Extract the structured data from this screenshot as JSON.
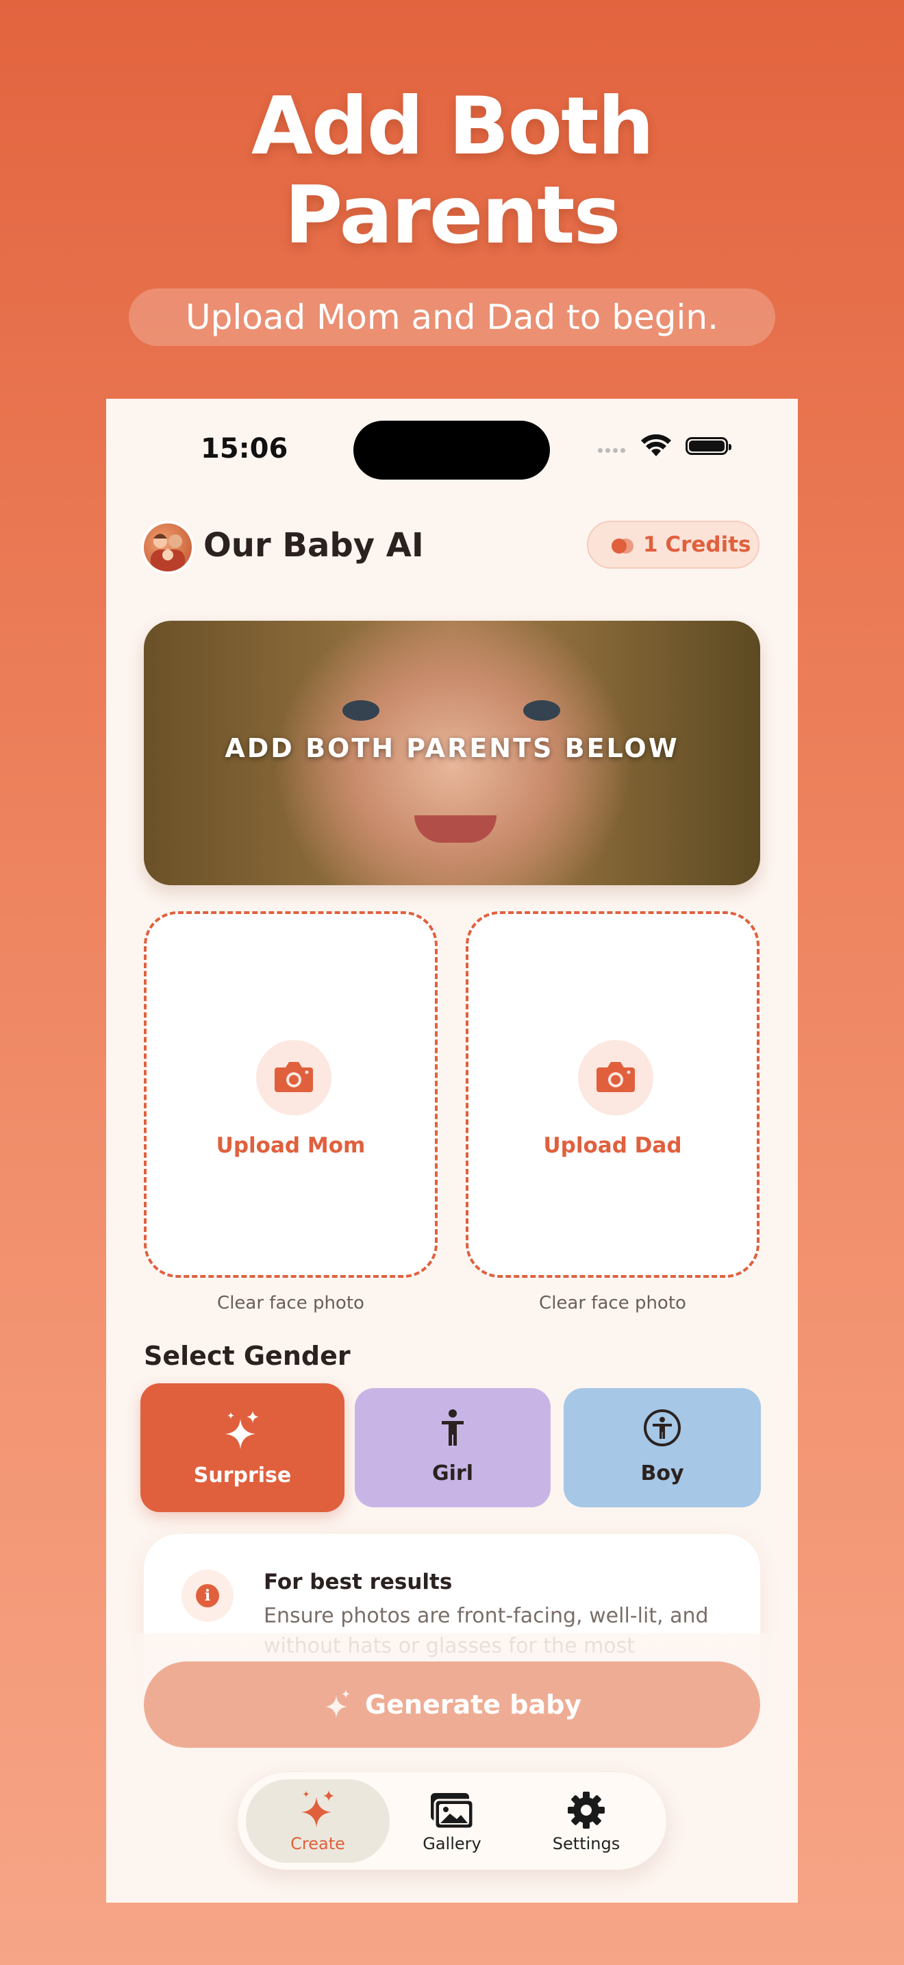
{
  "promo": {
    "headline_line1": "Add Both",
    "headline_line2": "Parents",
    "subtitle": "Upload Mom and Dad to begin."
  },
  "status_bar": {
    "time": "15:06"
  },
  "header": {
    "app_title": "Our Baby AI",
    "credits_label": "1 Credits"
  },
  "hero": {
    "overlay_text": "ADD BOTH PARENTS BELOW"
  },
  "uploads": {
    "mom": {
      "label": "Upload Mom",
      "caption": "Clear face photo"
    },
    "dad": {
      "label": "Upload Dad",
      "caption": "Clear face photo"
    }
  },
  "gender": {
    "title": "Select Gender",
    "options": [
      {
        "label": "Surprise",
        "icon": "sparkles-icon",
        "selected": true,
        "color": "#e0603d"
      },
      {
        "label": "Girl",
        "icon": "person-icon",
        "selected": false,
        "color": "#c8b5e6"
      },
      {
        "label": "Boy",
        "icon": "accessibility-icon",
        "selected": false,
        "color": "#a6c7e6"
      }
    ]
  },
  "tip": {
    "title": "For best results",
    "body": "Ensure photos are front-facing, well-lit, and without hats or glasses for the most accurate prediction."
  },
  "generate": {
    "label": "Generate baby",
    "enabled": false
  },
  "tabs": [
    {
      "label": "Create",
      "icon": "sparkles-icon",
      "active": true
    },
    {
      "label": "Gallery",
      "icon": "photos-icon",
      "active": false
    },
    {
      "label": "Settings",
      "icon": "gear-icon",
      "active": false
    }
  ],
  "colors": {
    "accent": "#e0603d",
    "background": "#fdf5f0",
    "girl": "#c8b5e6",
    "boy": "#a6c7e6"
  }
}
